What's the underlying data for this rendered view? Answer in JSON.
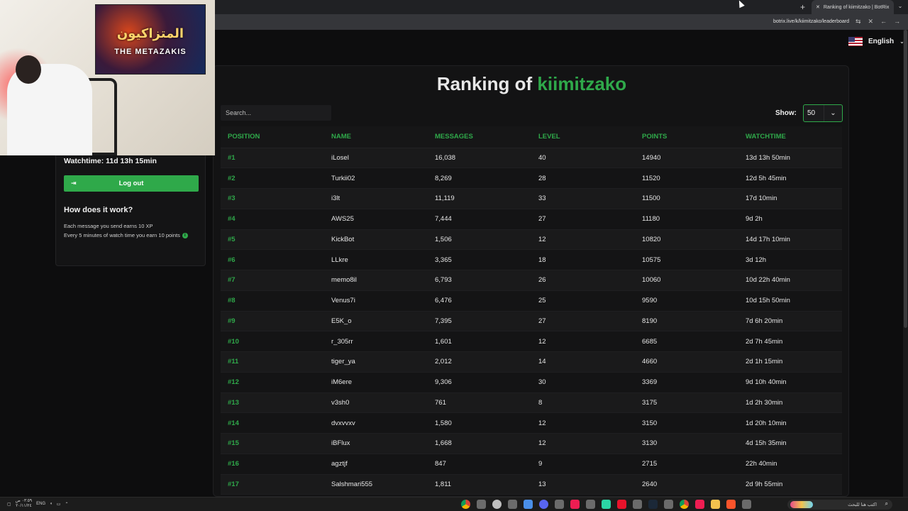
{
  "browser": {
    "tab_title": "Ranking of kiimitzako | BotRix",
    "url": "botrix.live/k/kiimitzako/leaderboard"
  },
  "header": {
    "language": "English"
  },
  "ranking": {
    "title_prefix": "Ranking of",
    "title_name": "kiimitzako",
    "search_placeholder": "Search...",
    "show_label": "Show:",
    "show_value": "50",
    "columns": [
      "POSITION",
      "NAME",
      "MESSAGES",
      "LEVEL",
      "POINTS",
      "WATCHTIME"
    ],
    "rows": [
      {
        "position": "#1",
        "name": "iLosel",
        "messages": "16,038",
        "level": "40",
        "points": "14940",
        "watchtime": "13d 13h 50min"
      },
      {
        "position": "#2",
        "name": "Turkii02",
        "messages": "8,269",
        "level": "28",
        "points": "11520",
        "watchtime": "12d 5h 45min"
      },
      {
        "position": "#3",
        "name": "i3lt",
        "messages": "11,119",
        "level": "33",
        "points": "11500",
        "watchtime": "17d 10min"
      },
      {
        "position": "#4",
        "name": "AWS25",
        "messages": "7,444",
        "level": "27",
        "points": "11180",
        "watchtime": "9d 2h"
      },
      {
        "position": "#5",
        "name": "KickBot",
        "messages": "1,506",
        "level": "12",
        "points": "10820",
        "watchtime": "14d 17h 10min"
      },
      {
        "position": "#6",
        "name": "LLkre",
        "messages": "3,365",
        "level": "18",
        "points": "10575",
        "watchtime": "3d 12h"
      },
      {
        "position": "#7",
        "name": "memo8il",
        "messages": "6,793",
        "level": "26",
        "points": "10060",
        "watchtime": "10d 22h 40min"
      },
      {
        "position": "#8",
        "name": "Venus7i",
        "messages": "6,476",
        "level": "25",
        "points": "9590",
        "watchtime": "10d 15h 50min"
      },
      {
        "position": "#9",
        "name": "E5K_o",
        "messages": "7,395",
        "level": "27",
        "points": "8190",
        "watchtime": "7d 6h 20min"
      },
      {
        "position": "#10",
        "name": "r_305rr",
        "messages": "1,601",
        "level": "12",
        "points": "6685",
        "watchtime": "2d 7h 45min"
      },
      {
        "position": "#11",
        "name": "tiger_ya",
        "messages": "2,012",
        "level": "14",
        "points": "4660",
        "watchtime": "2d 1h 15min"
      },
      {
        "position": "#12",
        "name": "iM6ere",
        "messages": "9,306",
        "level": "30",
        "points": "3369",
        "watchtime": "9d 10h 40min"
      },
      {
        "position": "#13",
        "name": "v3sh0",
        "messages": "761",
        "level": "8",
        "points": "3175",
        "watchtime": "1d 2h 30min"
      },
      {
        "position": "#14",
        "name": "dvxvvxv",
        "messages": "1,580",
        "level": "12",
        "points": "3150",
        "watchtime": "1d 20h 10min"
      },
      {
        "position": "#15",
        "name": "iBFlux",
        "messages": "1,668",
        "level": "12",
        "points": "3130",
        "watchtime": "4d 15h 35min"
      },
      {
        "position": "#16",
        "name": "agztjf",
        "messages": "847",
        "level": "9",
        "points": "2715",
        "watchtime": "22h 40min"
      },
      {
        "position": "#17",
        "name": "Salshmari555",
        "messages": "1,811",
        "level": "13",
        "points": "2640",
        "watchtime": "2d 9h 55min"
      }
    ]
  },
  "sidebar": {
    "watchtime": "Watchtime: 11d 13h 15min",
    "logout_label": "Log out",
    "how_title": "How does it work?",
    "note_1": "Each message you send earns 10 XP",
    "note_2": "Every 5 minutes of watch time you earn 10 points"
  },
  "webcam": {
    "banner_arabic": "المتزاكيون",
    "banner_english": "THE METAZAKIS"
  },
  "taskbar": {
    "lang": "ENG",
    "time": "٠٣:٥٩ ص",
    "date": "٢٠/١١/٢٤",
    "search_text": "اكتب هنا للبحث"
  },
  "colors": {
    "accent": "#2fa94a",
    "background": "#0d0d0e",
    "panel": "#131314"
  },
  "taskbar_apps": [
    "chrome",
    "generic",
    "xbox",
    "generic",
    "vpn",
    "discord",
    "generic",
    "tiktok",
    "generic",
    "capcut",
    "adobe",
    "generic",
    "steam",
    "generic",
    "chrome",
    "tiktok",
    "folder",
    "brave",
    "generic"
  ]
}
